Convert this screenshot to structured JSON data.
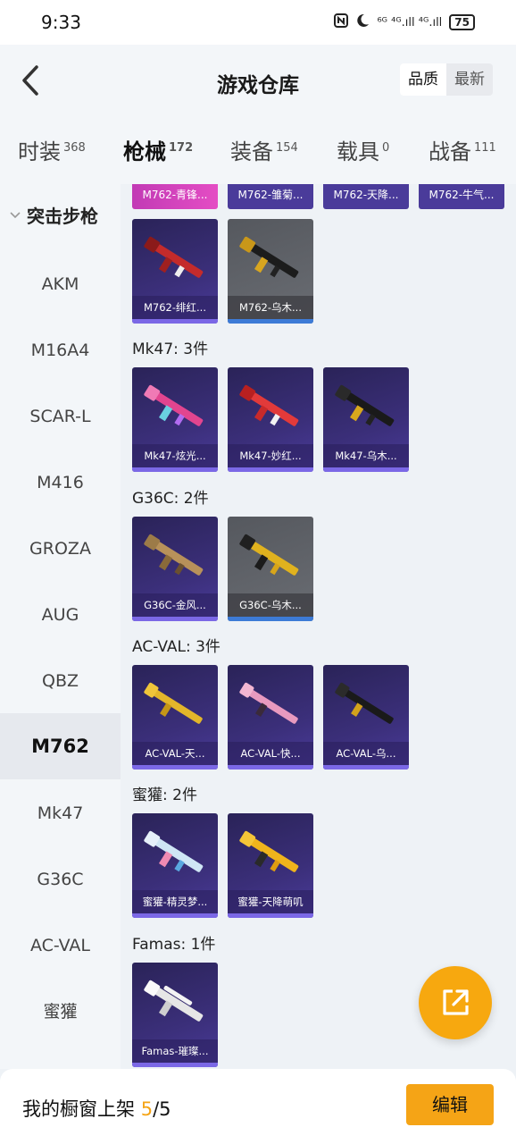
{
  "status": {
    "time": "9:33",
    "battery": "75",
    "net": "⁶ᴳ ⁴ᴳ.ıll ⁴ᴳ.ıll"
  },
  "header": {
    "title": "游戏仓库",
    "sort": [
      "品质",
      "最新"
    ]
  },
  "tabs": [
    {
      "label": "时装",
      "count": "368"
    },
    {
      "label": "枪械",
      "count": "172"
    },
    {
      "label": "装备",
      "count": "154"
    },
    {
      "label": "载具",
      "count": "0"
    },
    {
      "label": "战备",
      "count": "111"
    }
  ],
  "sidebar": {
    "category": "突击步枪",
    "items": [
      "AKM",
      "M16A4",
      "SCAR-L",
      "M416",
      "GROZA",
      "AUG",
      "QBZ",
      "M762",
      "Mk47",
      "G36C",
      "AC-VAL",
      "蜜獾"
    ]
  },
  "top_strip": [
    "M762-青锋...",
    "M762-雏菊...",
    "M762-天降...",
    "M762-牛气..."
  ],
  "m762_cards": [
    "M762-绯红...",
    "M762-乌木..."
  ],
  "sections": [
    {
      "title": "Mk47: 3件",
      "cards": [
        "Mk47-炫光...",
        "Mk47-妙红...",
        "Mk47-乌木..."
      ]
    },
    {
      "title": "G36C: 2件",
      "cards": [
        "G36C-金风...",
        "G36C-乌木..."
      ]
    },
    {
      "title": "AC-VAL: 3件",
      "cards": [
        "AC-VAL-天...",
        "AC-VAL-快...",
        "AC-VAL-乌..."
      ]
    },
    {
      "title": "蜜獾: 2件",
      "cards": [
        "蜜獾-精灵梦...",
        "蜜獾-天降萌叽"
      ]
    },
    {
      "title": "Famas: 1件",
      "cards": [
        "Famas-璀璨..."
      ]
    }
  ],
  "bottom": {
    "label": "我的橱窗上架",
    "count": "5",
    "total": "/5",
    "edit": "编辑"
  },
  "colors": {
    "accent": "#f5a416",
    "card_purple": "#3b2f7a",
    "card_gray": "#5f6268"
  }
}
